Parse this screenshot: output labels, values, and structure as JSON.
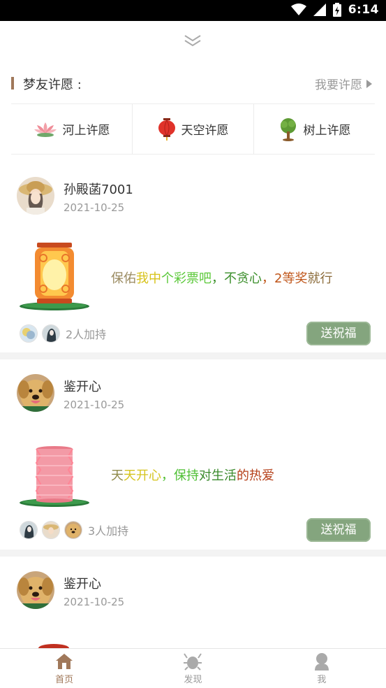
{
  "status_bar": {
    "time": "6:14"
  },
  "section": {
    "title": "梦友许愿 :",
    "action": "我要许愿"
  },
  "categories": [
    {
      "label": "河上许愿",
      "icon": "lotus-icon"
    },
    {
      "label": "天空许愿",
      "icon": "sky-lantern-icon"
    },
    {
      "label": "树上许愿",
      "icon": "tree-icon"
    }
  ],
  "posts": [
    {
      "username": "孙殿菡7001",
      "date": "2021-10-25",
      "lantern": "orange-lantern",
      "wish_segments": [
        "保佑",
        "我中",
        "个彩票吧",
        "，不贪心",
        "，2等奖",
        "就行"
      ],
      "support_count": "2人加持",
      "bless_label": "送祝福"
    },
    {
      "username": "鉴开心",
      "date": "2021-10-25",
      "lantern": "pink-lantern",
      "wish_segments": [
        "天",
        "天开心",
        "，保持",
        "对生活",
        "的热爱"
      ],
      "support_count": "3人加持",
      "bless_label": "送祝福"
    },
    {
      "username": "鉴开心",
      "date": "2021-10-25"
    }
  ],
  "wish_colors": {
    "post0": [
      "#9a8a60",
      "#d7c21a",
      "#5cc93a",
      "#3a8e2a",
      "#c0561a",
      "#8b6b3a"
    ],
    "post1": [
      "#8f8a4a",
      "#d5c41e",
      "#4fbf34",
      "#3a8a2c",
      "#b5401a"
    ]
  },
  "tab_bar": [
    {
      "label": "首页",
      "icon": "home-icon",
      "active": true
    },
    {
      "label": "发现",
      "icon": "discover-icon",
      "active": false
    },
    {
      "label": "我",
      "icon": "profile-icon",
      "active": false
    }
  ],
  "accent_color": "#a0785a",
  "button_color": "#84a57e"
}
